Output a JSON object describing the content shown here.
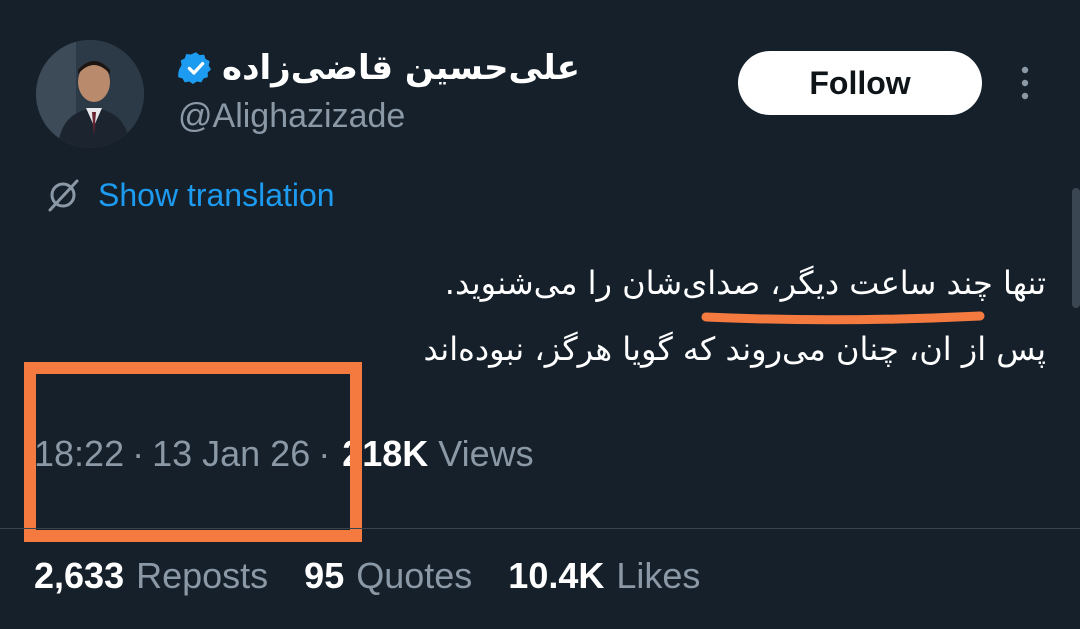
{
  "author": {
    "display_name": "علی‌حسین قاضی‌زاده",
    "handle": "@Alighazizade",
    "verified": true
  },
  "header": {
    "follow_label": "Follow"
  },
  "translation": {
    "label": "Show translation"
  },
  "tweet": {
    "lines": [
      "تنها چند ساعت دیگر، صدای‌شان را می‌شنوید.",
      "پس از ان، چنان می‌روند که گویا هرگز، نبوده‌اند"
    ]
  },
  "meta": {
    "time": "18:22",
    "separator": "·",
    "date": "13 Jan 26",
    "views_count": "218K",
    "views_label": "Views"
  },
  "stats": {
    "reposts_count": "2,633",
    "reposts_label": "Reposts",
    "quotes_count": "95",
    "quotes_label": "Quotes",
    "likes_count": "10.4K",
    "likes_label": "Likes"
  },
  "colors": {
    "background": "#15202b",
    "accent": "#1d9bf0",
    "muted_text": "#8b98a5",
    "annotation": "#f47a40"
  },
  "icons": {
    "verified": "verified-badge-icon",
    "translate": "globe-slash-icon",
    "more": "more-vertical-icon"
  }
}
